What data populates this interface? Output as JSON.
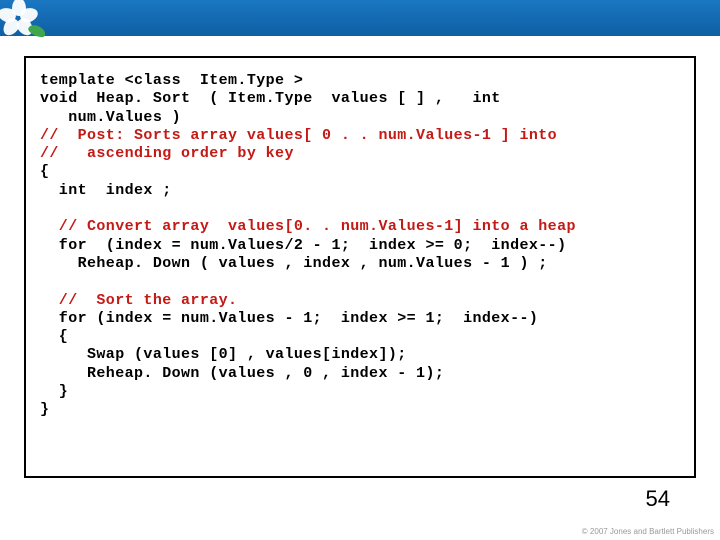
{
  "code": {
    "l01": "template <class  Item.Type >",
    "l02": "void  Heap. Sort  ( Item.Type  values [ ] ,   int",
    "l03": "   num.Values )",
    "l04": "//  Post: Sorts array values[ 0 . . num.Values-1 ] into",
    "l05": "//   ascending order by key",
    "l06": "{",
    "l07": "  int  index ;",
    "l08": "",
    "l09": "  // Convert array  values[0. . num.Values-1] into a heap",
    "l10": "  for  (index = num.Values/2 - 1;  index >= 0;  index--)",
    "l11": "    Reheap. Down ( values , index , num.Values - 1 ) ;",
    "l12": "",
    "l13": "  //  Sort the array.",
    "l14": "  for (index = num.Values - 1;  index >= 1;  index--)",
    "l15": "  {",
    "l16": "     Swap (values [0] , values[index]);",
    "l17": "     Reheap. Down (values , 0 , index - 1);",
    "l18": "  }",
    "l19": "}"
  },
  "page_number": "54",
  "copyright": "© 2007 Jones and Bartlett Publishers"
}
